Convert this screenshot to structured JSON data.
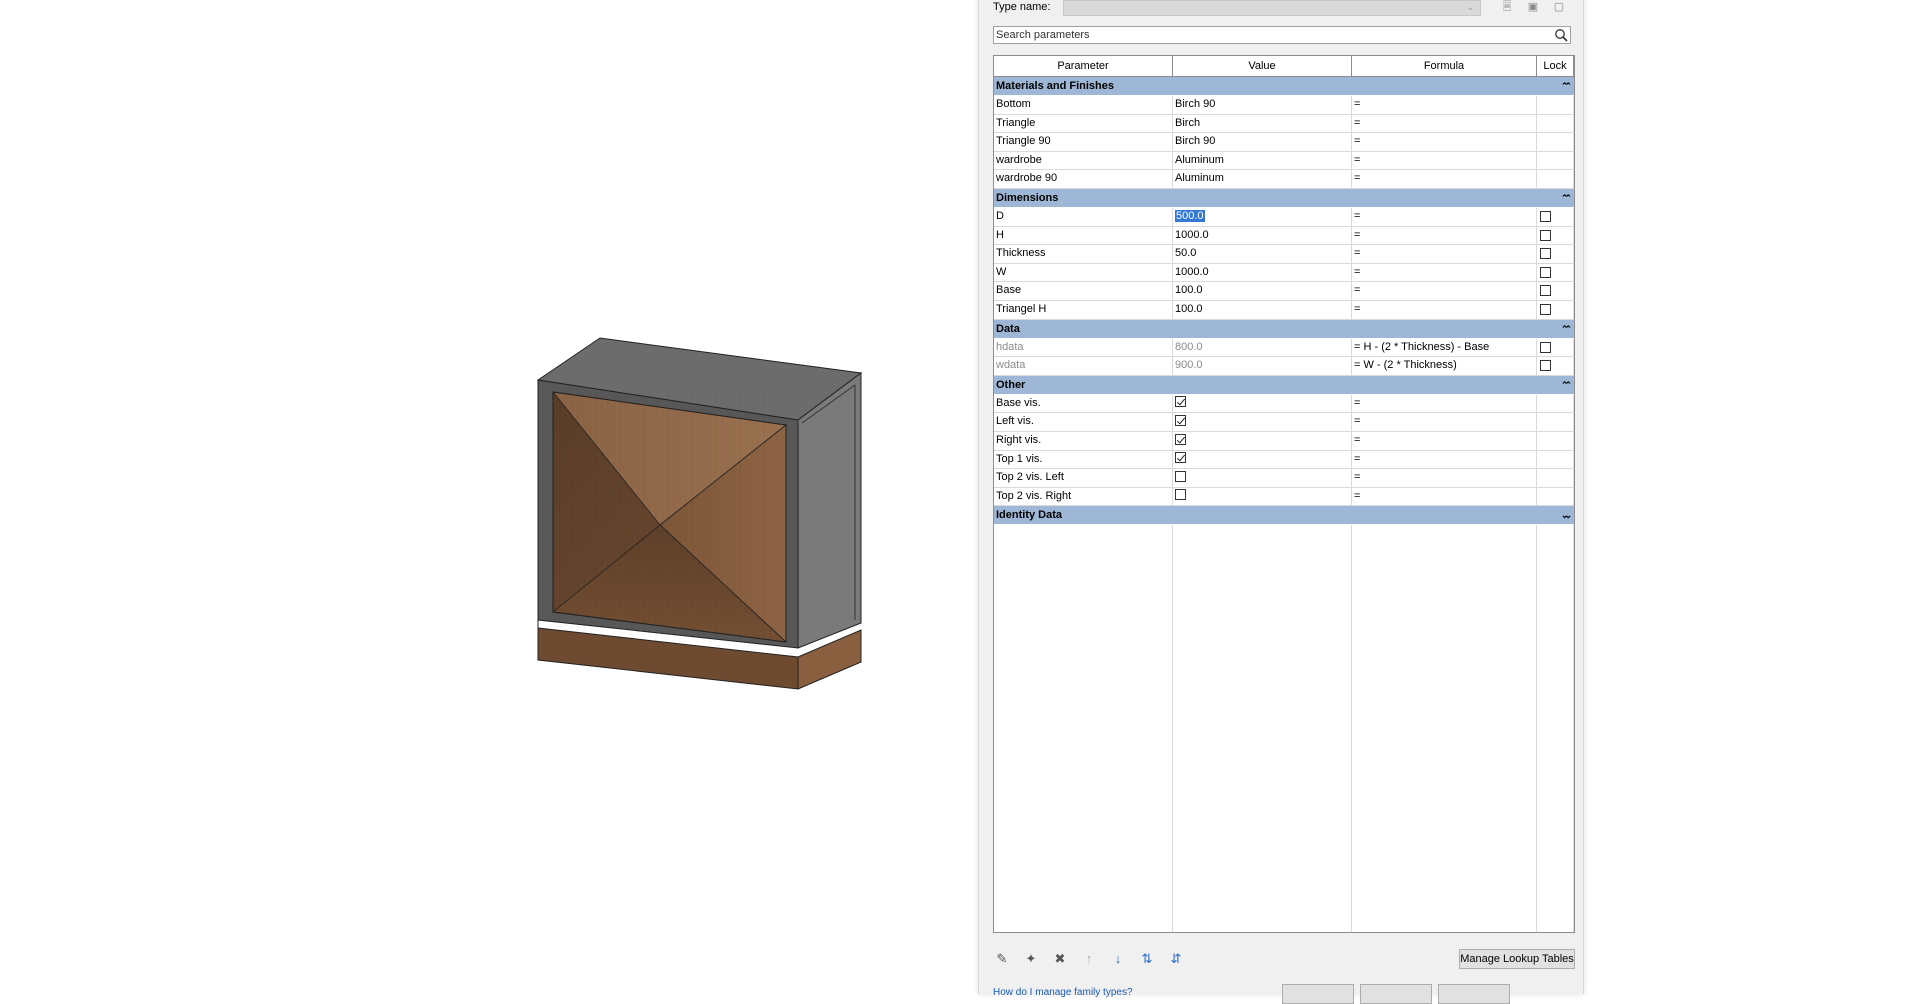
{
  "dialog": {
    "type_name_label": "Type name:",
    "type_name_value": "",
    "search_placeholder": "Search parameters",
    "columns": [
      "Parameter",
      "Value",
      "Formula",
      "Lock"
    ],
    "groups": [
      {
        "title": "Materials and Finishes",
        "collapse_icon": "chevron-double-up-icon",
        "rows": [
          {
            "param": "Bottom",
            "value": "Birch 90",
            "formula": "=",
            "lock": null
          },
          {
            "param": "Triangle",
            "value": "Birch",
            "formula": "=",
            "lock": null
          },
          {
            "param": "Triangle 90",
            "value": "Birch 90",
            "formula": "=",
            "lock": null
          },
          {
            "param": "wardrobe",
            "value": "Aluminum",
            "formula": "=",
            "lock": null
          },
          {
            "param": "wardrobe 90",
            "value": "Aluminum",
            "formula": "=",
            "lock": null
          }
        ]
      },
      {
        "title": "Dimensions",
        "collapse_icon": "chevron-double-up-icon",
        "rows": [
          {
            "param": "D",
            "value": "500.0",
            "formula": "=",
            "lock": false,
            "selected": true
          },
          {
            "param": "H",
            "value": "1000.0",
            "formula": "=",
            "lock": false
          },
          {
            "param": "Thickness",
            "value": "50.0",
            "formula": "=",
            "lock": false
          },
          {
            "param": "W",
            "value": "1000.0",
            "formula": "=",
            "lock": false
          },
          {
            "param": "Base",
            "value": "100.0",
            "formula": "=",
            "lock": false
          },
          {
            "param": "Triangel H",
            "value": "100.0",
            "formula": "=",
            "lock": false
          }
        ]
      },
      {
        "title": "Data",
        "collapse_icon": "chevron-double-up-icon",
        "rows": [
          {
            "param": "hdata",
            "value": "800.0",
            "formula": "= H - (2 * Thickness) - Base",
            "lock": false,
            "dim": true
          },
          {
            "param": "wdata",
            "value": "900.0",
            "formula": "= W - (2 * Thickness)",
            "lock": false,
            "dim": true
          }
        ]
      },
      {
        "title": "Other",
        "collapse_icon": "chevron-double-up-icon",
        "rows": [
          {
            "param": "Base vis.",
            "value_check": true,
            "formula": "=",
            "lock": null
          },
          {
            "param": "Left vis.",
            "value_check": true,
            "formula": "=",
            "lock": null
          },
          {
            "param": "Right vis.",
            "value_check": true,
            "formula": "=",
            "lock": null
          },
          {
            "param": "Top 1 vis.",
            "value_check": true,
            "formula": "=",
            "lock": null
          },
          {
            "param": "Top 2 vis. Left",
            "value_check": false,
            "formula": "=",
            "lock": null
          },
          {
            "param": "Top 2 vis. Right",
            "value_check": false,
            "formula": "=",
            "lock": null
          }
        ]
      },
      {
        "title": "Identity Data",
        "collapse_icon": "chevron-double-down-icon",
        "rows": []
      }
    ],
    "footer": {
      "tools": [
        "edit-pencil-icon",
        "new-parameter-icon",
        "delete-parameter-icon",
        "move-up-icon",
        "move-down-icon",
        "sort-ascending-icon",
        "sort-descending-icon"
      ],
      "lookup_button": "Manage Lookup Tables",
      "help_link": "How do I manage family types?"
    }
  },
  "colors": {
    "group_header": "#9fb7d6",
    "selection": "#3378d4",
    "wood": "#7b5538",
    "frame": "#5a5a5a"
  }
}
